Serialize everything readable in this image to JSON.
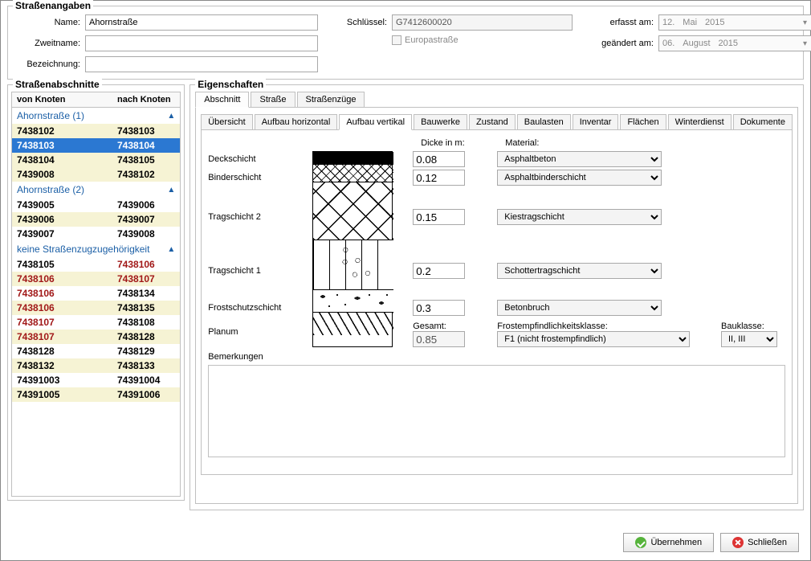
{
  "top": {
    "group_title": "Straßenangaben",
    "name_label": "Name:",
    "name_value": "Ahornstraße",
    "zweitname_label": "Zweitname:",
    "zweitname_value": "",
    "bezeichnung_label": "Bezeichnung:",
    "bezeichnung_value": "",
    "schluessel_label": "Schlüssel:",
    "schluessel_value": "G7412600020",
    "europa_label": "Europastraße",
    "erfasst_label": "erfasst am:",
    "erfasst_d": "12.",
    "erfasst_m": "Mai",
    "erfasst_y": "2015",
    "geaendert_label": "geändert am:",
    "geaendert_d": "06.",
    "geaendert_m": "August",
    "geaendert_y": "2015"
  },
  "sidebar": {
    "group_title": "Straßenabschnitte",
    "col1": "von Knoten",
    "col2": "nach Knoten",
    "groups": [
      {
        "title": "Ahornstraße (1)",
        "items": [
          {
            "a": "7438102",
            "b": "7438103",
            "y": true
          },
          {
            "a": "7438103",
            "b": "7438104",
            "sel": true
          },
          {
            "a": "7438104",
            "b": "7438105",
            "y": true
          },
          {
            "a": "7439008",
            "b": "7438102",
            "y": true
          }
        ]
      },
      {
        "title": "Ahornstraße (2)",
        "items": [
          {
            "a": "7439005",
            "b": "7439006"
          },
          {
            "a": "7439006",
            "b": "7439007",
            "y": true
          },
          {
            "a": "7439007",
            "b": "7439008"
          }
        ]
      },
      {
        "title": "keine Straßenzugzugehörigkeit",
        "items": [
          {
            "a": "7438105",
            "b": "7438106",
            "br": true
          },
          {
            "a": "7438106",
            "b": "7438107",
            "y": true,
            "ar": true,
            "br": true
          },
          {
            "a": "7438106",
            "b": "7438134",
            "ar": true
          },
          {
            "a": "7438106",
            "b": "7438135",
            "y": true,
            "ar": true
          },
          {
            "a": "7438107",
            "b": "7438108",
            "ar": true
          },
          {
            "a": "7438107",
            "b": "7438128",
            "y": true,
            "ar": true
          },
          {
            "a": "7438128",
            "b": "7438129"
          },
          {
            "a": "7438132",
            "b": "7438133",
            "y": true
          },
          {
            "a": "74391003",
            "b": "74391004"
          },
          {
            "a": "74391005",
            "b": "74391006",
            "y": true
          }
        ]
      }
    ]
  },
  "main": {
    "group_title": "Eigenschaften",
    "tabs": [
      "Abschnitt",
      "Straße",
      "Straßenzüge"
    ],
    "active_tab": 0,
    "subtabs": [
      "Übersicht",
      "Aufbau horizontal",
      "Aufbau vertikal",
      "Bauwerke",
      "Zustand",
      "Baulasten",
      "Inventar",
      "Flächen",
      "Winterdienst",
      "Dokumente"
    ],
    "active_subtab": 2,
    "dicke_label": "Dicke in m:",
    "material_label": "Material:",
    "layers": [
      {
        "name": "Deckschicht",
        "thick": "0.08",
        "mat": "Asphaltbeton"
      },
      {
        "name": "Binderschicht",
        "thick": "0.12",
        "mat": "Asphaltbinderschicht"
      },
      {
        "name": "Tragschicht 2",
        "thick": "0.15",
        "mat": "Kiestragschicht"
      },
      {
        "name": "Tragschicht 1",
        "thick": "0.2",
        "mat": "Schottertragschicht"
      },
      {
        "name": "Frostschutzschicht",
        "thick": "0.3",
        "mat": "Betonbruch"
      }
    ],
    "planum_label": "Planum",
    "gesamt_label": "Gesamt:",
    "gesamt_value": "0.85",
    "frost_label": "Frostempfindlichkeitsklasse:",
    "frost_value": "F1 (nicht frostempfindlich)",
    "bauklasse_label": "Bauklasse:",
    "bauklasse_value": "II, III",
    "bemerkungen_label": "Bemerkungen",
    "bemerkungen_value": ""
  },
  "buttons": {
    "ok": "Übernehmen",
    "close": "Schließen"
  }
}
